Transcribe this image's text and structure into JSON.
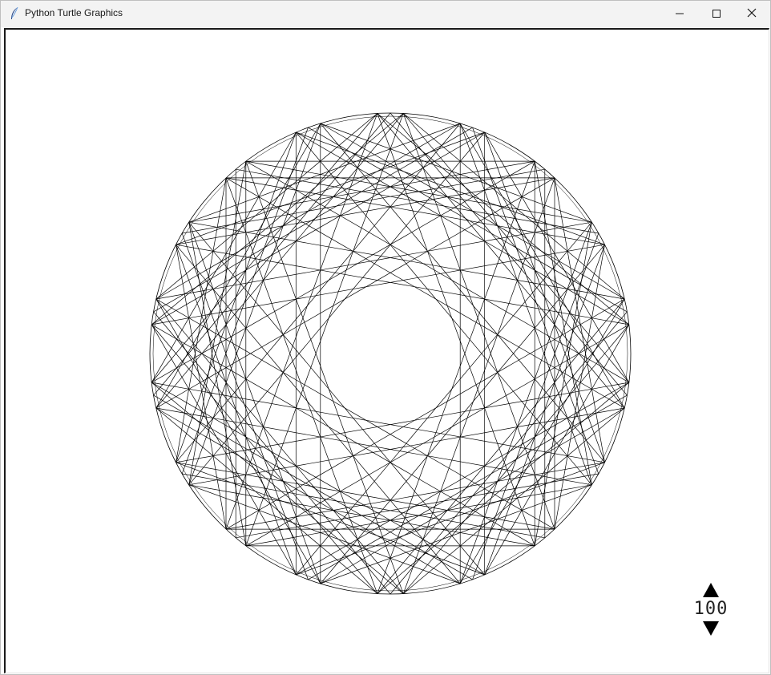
{
  "window": {
    "title": "Python Turtle Graphics",
    "icon": "feather-icon",
    "controls": [
      "minimize-icon",
      "maximize-icon",
      "close-icon"
    ]
  },
  "canvas": {
    "background": "#ffffff",
    "stroke_color": "#000000",
    "pattern": "circle-chord-star"
  },
  "counter": {
    "value": "100",
    "up_icon": "triangle-up-icon",
    "down_icon": "triangle-down-icon"
  }
}
